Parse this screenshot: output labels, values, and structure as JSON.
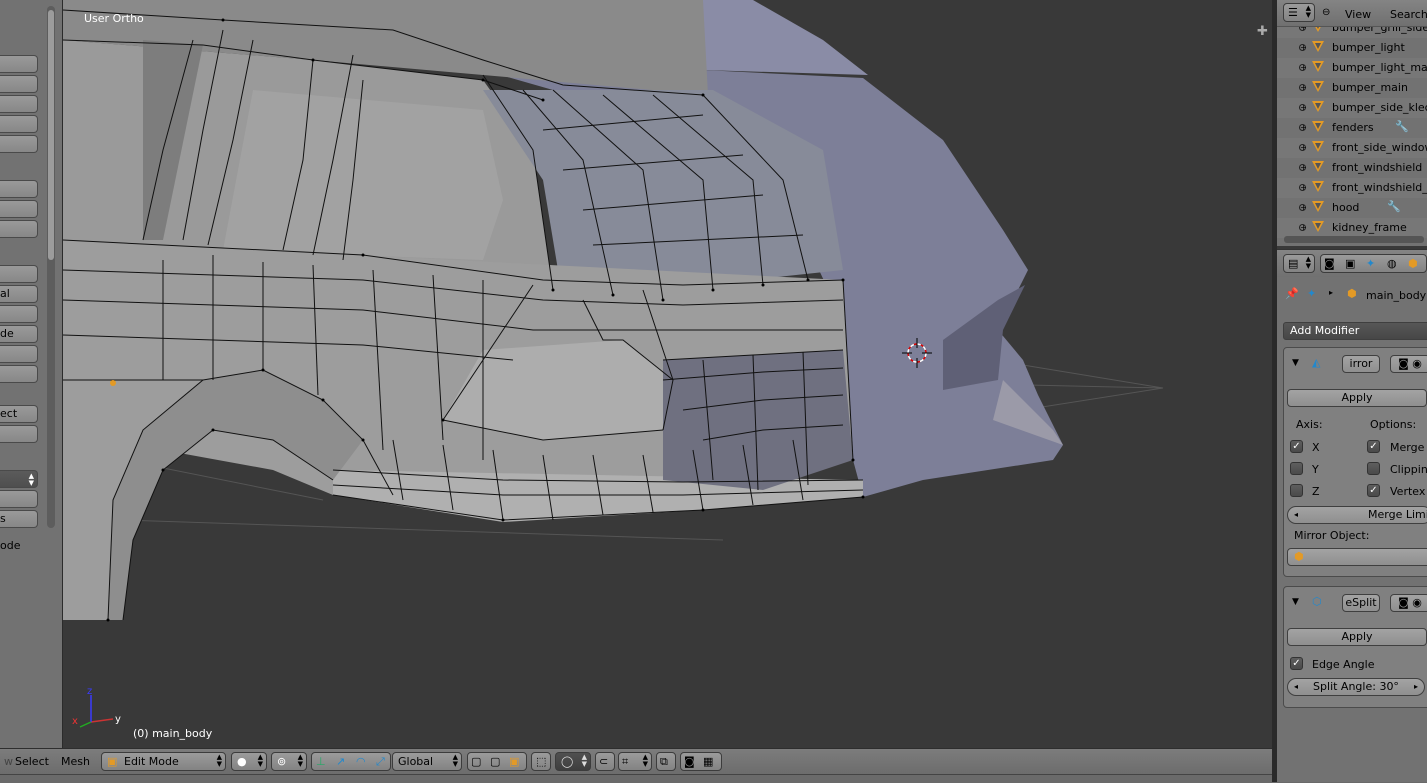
{
  "viewport": {
    "view_label": "User Ortho",
    "active_object_label": "(0) main_body",
    "axes": {
      "x": "x",
      "y": "y",
      "z": "z"
    }
  },
  "toolshelf": {
    "buttons": [
      "",
      "",
      "",
      "",
      "",
      "",
      "",
      "",
      "",
      "al",
      "",
      "de",
      "",
      "",
      "ect",
      "",
      "",
      "",
      "s"
    ],
    "footer_text": "ode"
  },
  "header": {
    "menus": [
      "Select",
      "Mesh"
    ],
    "mode": "Edit Mode",
    "orientation": "Global"
  },
  "outliner": {
    "menus": [
      "View",
      "Search"
    ],
    "items": [
      {
        "name": "bumper_grill_side"
      },
      {
        "name": "bumper_light"
      },
      {
        "name": "bumper_light_main"
      },
      {
        "name": "bumper_main"
      },
      {
        "name": "bumper_side_klech"
      },
      {
        "name": "fenders"
      },
      {
        "name": "front_side_window"
      },
      {
        "name": "front_windshield"
      },
      {
        "name": "front_windshield_de"
      },
      {
        "name": "hood"
      },
      {
        "name": "kidney_frame"
      }
    ]
  },
  "properties": {
    "object_name": "main_body",
    "add_modifier_label": "Add Modifier",
    "mirror": {
      "name_field": "irror",
      "apply_label": "Apply",
      "axis_label": "Axis:",
      "options_label": "Options:",
      "axis_x": "X",
      "axis_y": "Y",
      "axis_z": "Z",
      "merge": "Merge",
      "clipping": "Clipping",
      "vertex": "Vertex G",
      "merge_limit": "Merge Limi",
      "mirror_object_label": "Mirror Object:"
    },
    "edge_split": {
      "name_field": "eSplit",
      "apply_label": "Apply",
      "edge_angle_label": "Edge Angle",
      "split_angle": "Split Angle: 30°"
    }
  },
  "colors": {
    "accent": "#e39a26",
    "viewport_bg": "#393939",
    "panel_bg": "#727272",
    "mesh": "#7e7f96"
  }
}
